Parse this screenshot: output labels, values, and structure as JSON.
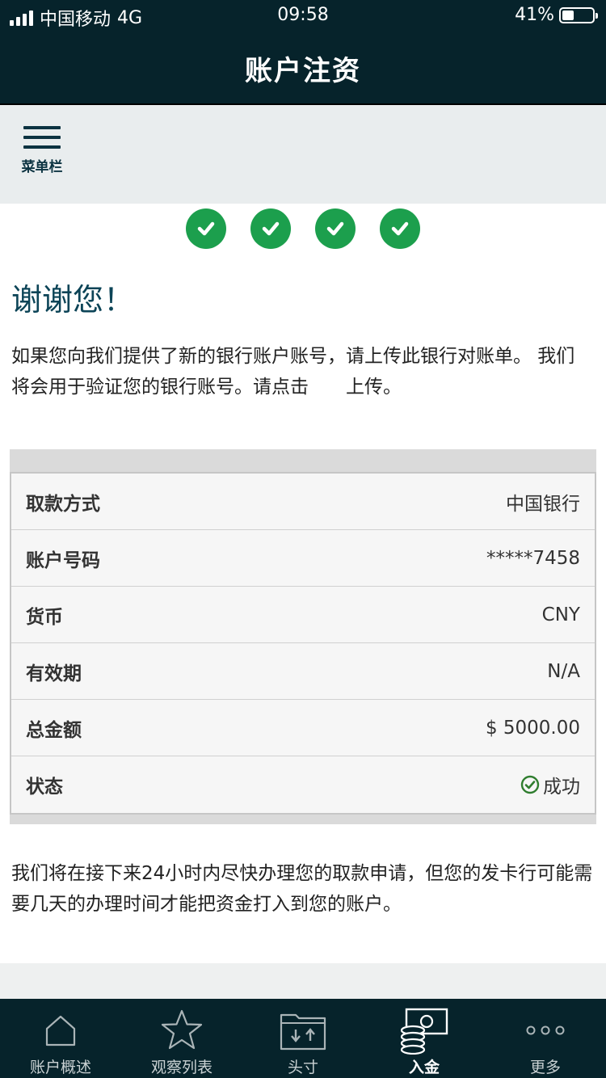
{
  "status_bar": {
    "carrier": "中国移动",
    "network": "4G",
    "time": "09:58",
    "battery": "41%",
    "battery_level": 0.41
  },
  "header": {
    "title": "账户注资"
  },
  "menu": {
    "label": "菜单栏"
  },
  "steps": {
    "completed": 4,
    "icon": "checkmark-icon"
  },
  "thanks": "谢谢您！",
  "intro": "如果您向我们提供了新的银行账户账号，请上传此银行对账单。 我们将会用于验证您的银行账号。请点击　　上传。",
  "details": {
    "rows": [
      {
        "key": "取款方式",
        "value": "中国银行"
      },
      {
        "key": "账户号码",
        "value": "*****7458"
      },
      {
        "key": "货币",
        "value": "CNY"
      },
      {
        "key": "有效期",
        "value": "N/A"
      },
      {
        "key": "总金额",
        "value": "$ 5000.00"
      },
      {
        "key": "状态",
        "value": "成功"
      }
    ],
    "status_color": "#2f7d2e"
  },
  "note": "我们将在接下来24小时内尽快办理您的取款申请，但您的发卡行可能需要几天的办理时间才能把资金打入到您的账户。",
  "tabs": [
    {
      "label": "账户概述",
      "icon": "home-icon",
      "active": false
    },
    {
      "label": "观察列表",
      "icon": "star-icon",
      "active": false
    },
    {
      "label": "头寸",
      "icon": "folder-arrows-icon",
      "active": false
    },
    {
      "label": "入金",
      "icon": "money-coins-icon",
      "active": true
    },
    {
      "label": "更多",
      "icon": "more-dots-icon",
      "active": false
    }
  ],
  "colors": {
    "header_bg": "#06232b",
    "step_green": "#1c9f4d",
    "title_color": "#0c4457"
  }
}
